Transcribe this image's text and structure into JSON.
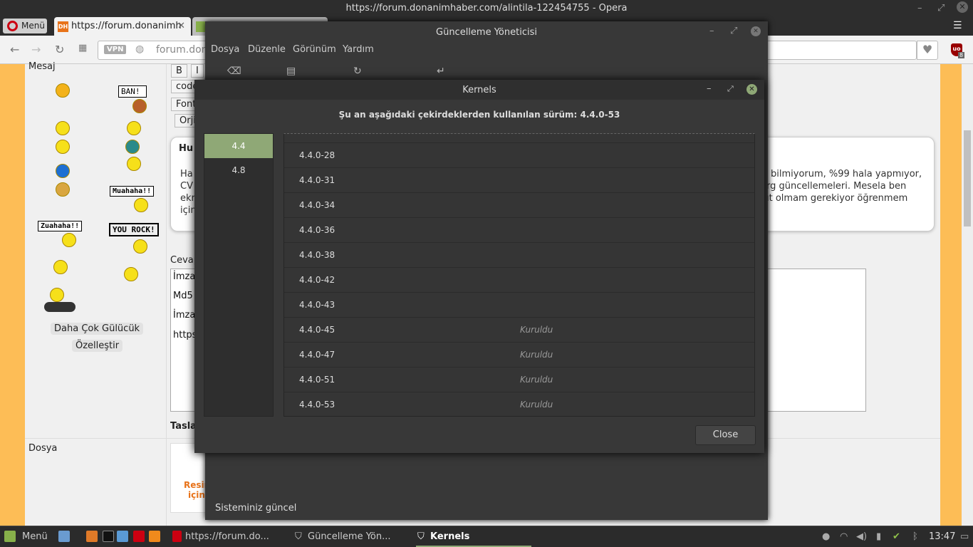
{
  "browser": {
    "window_title": "https://forum.donanimhaber.com/alintila-122454755 - Opera",
    "menu_label": "Menü",
    "tabs": [
      {
        "label": "https://forum.donanimh",
        "favicon": "DH"
      },
      {
        "label": ""
      }
    ],
    "url_display": "forum.dona",
    "vpn_badge": "VPN",
    "ublock_count": "8"
  },
  "forum": {
    "message_label": "Mesaj",
    "editor_buttons": [
      "B",
      "I",
      "code",
      "Font",
      "Orji"
    ],
    "signs": [
      "BAN!",
      "Muahaha!!",
      "Zuahaha!!",
      "YOU ROCK!"
    ],
    "more_smileys": "Daha Çok Gülücük",
    "customize": "Özelleştir",
    "post": {
      "heading": "Hu",
      "lines_left": [
        "Ha",
        "CV",
        "ekr",
        "için"
      ],
      "lines_right": [
        "bilmiyorum, %99 hala yapmıyor,",
        "rg güncellemeleri. Mesela ben",
        "ıt olmam gerekiyor öğrenmem"
      ]
    },
    "reply_label": "Cevap",
    "reply_lines": [
      "İmzal",
      "Md5 ",
      "İmzal",
      "https"
    ],
    "draft_label": "Tasla",
    "file_label": "Dosya",
    "upload_text": [
      "Resim",
      "için"
    ]
  },
  "update_manager": {
    "title": "Güncelleme Yöneticisi",
    "menu": [
      "Dosya",
      "Düzenle",
      "Görünüm",
      "Yardım"
    ],
    "status": "Sisteminiz güncel"
  },
  "kernels": {
    "title": "Kernels",
    "heading": "Şu an aşağıdaki çekirdeklerden kullanılan sürüm: 4.4.0-53",
    "versions": [
      {
        "label": "4.4",
        "selected": true
      },
      {
        "label": "4.8",
        "selected": false
      }
    ],
    "rows": [
      {
        "version": "4.4.0-28",
        "status": ""
      },
      {
        "version": "4.4.0-31",
        "status": ""
      },
      {
        "version": "4.4.0-34",
        "status": ""
      },
      {
        "version": "4.4.0-36",
        "status": ""
      },
      {
        "version": "4.4.0-38",
        "status": ""
      },
      {
        "version": "4.4.0-42",
        "status": ""
      },
      {
        "version": "4.4.0-43",
        "status": ""
      },
      {
        "version": "4.4.0-45",
        "status": "Kuruldu"
      },
      {
        "version": "4.4.0-47",
        "status": "Kuruldu"
      },
      {
        "version": "4.4.0-51",
        "status": "Kuruldu"
      },
      {
        "version": "4.4.0-53",
        "status": "Kuruldu"
      }
    ],
    "close_label": "Close",
    "accent": "#8fa876"
  },
  "taskbar": {
    "menu_label": "Menü",
    "windows": [
      "https://forum.do...",
      "Güncelleme Yön...",
      "Kernels"
    ],
    "clock": "13:47"
  }
}
